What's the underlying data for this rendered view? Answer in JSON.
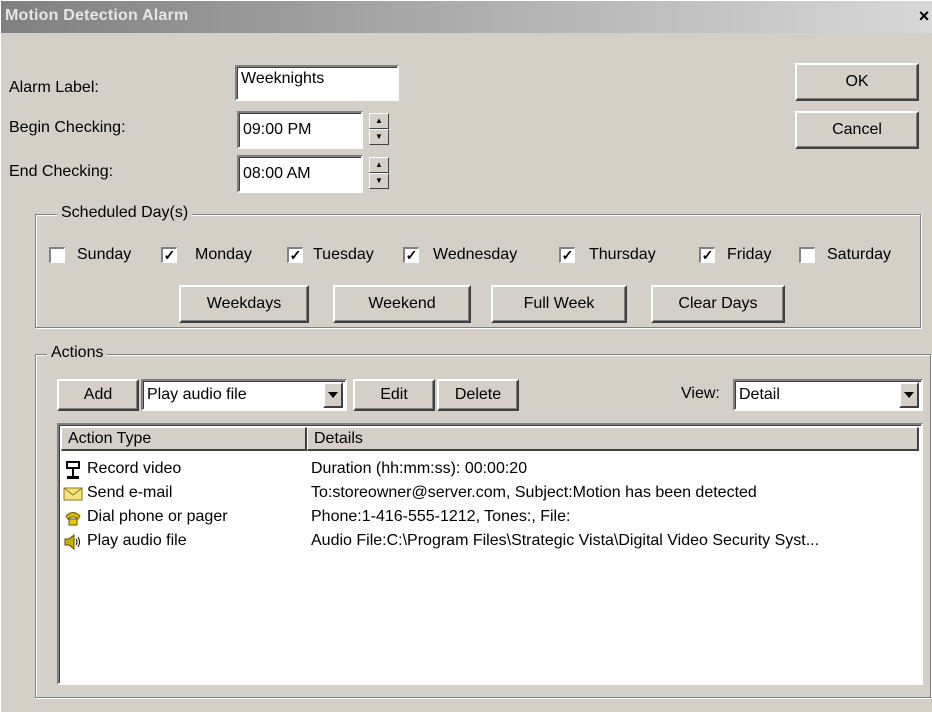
{
  "window": {
    "title": "Motion Detection Alarm",
    "close_glyph": "×"
  },
  "form": {
    "alarm_label": {
      "label": "Alarm Label:",
      "value": "Weeknights"
    },
    "begin_checking": {
      "label": "Begin Checking:",
      "value": "09:00 PM"
    },
    "end_checking": {
      "label": "End Checking:",
      "value": "08:00 AM"
    }
  },
  "buttons": {
    "ok": "OK",
    "cancel": "Cancel"
  },
  "schedule": {
    "title": "Scheduled Day(s)",
    "days": [
      {
        "label": "Sunday",
        "checked": false
      },
      {
        "label": "Monday",
        "checked": true
      },
      {
        "label": "Tuesday",
        "checked": true
      },
      {
        "label": "Wednesday",
        "checked": true
      },
      {
        "label": "Thursday",
        "checked": true
      },
      {
        "label": "Friday",
        "checked": true
      },
      {
        "label": "Saturday",
        "checked": false
      }
    ],
    "presets": {
      "weekdays": "Weekdays",
      "weekend": "Weekend",
      "full_week": "Full Week",
      "clear_days": "Clear Days"
    }
  },
  "actions": {
    "title": "Actions",
    "add": "Add",
    "action_select": "Play audio file",
    "edit": "Edit",
    "delete": "Delete",
    "view_label": "View:",
    "view_select": "Detail",
    "columns": {
      "type": "Action Type",
      "details": "Details"
    },
    "rows": [
      {
        "icon": "video-camera-icon",
        "type": "Record video",
        "details": "Duration (hh:mm:ss): 00:00:20"
      },
      {
        "icon": "envelope-icon",
        "type": "Send e-mail",
        "details": "To:storeowner@server.com, Subject:Motion has been detected"
      },
      {
        "icon": "phone-icon",
        "type": "Dial phone or pager",
        "details": "Phone:1-416-555-1212, Tones:, File:"
      },
      {
        "icon": "speaker-icon",
        "type": "Play audio file",
        "details": "Audio File:C:\\Program Files\\Strategic Vista\\Digital Video Security Syst..."
      }
    ]
  }
}
